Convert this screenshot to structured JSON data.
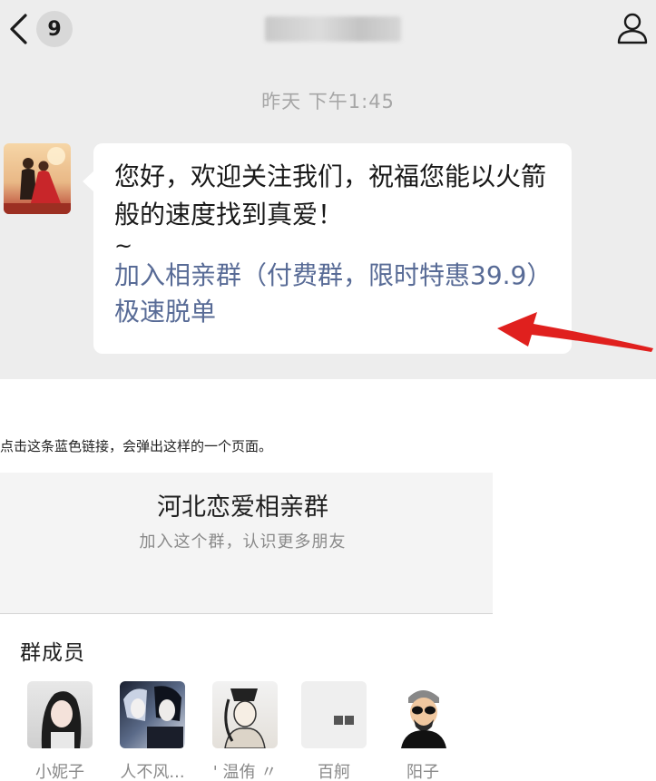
{
  "chat": {
    "unread_badge": "9",
    "timestamp": "昨天 下午1:45",
    "message": {
      "greeting": "您好，欢迎关注我们，祝福您能以火箭般的速度找到真爱！",
      "tilde": "~",
      "link_text": "加入相亲群（付费群，限时特惠39.9）极速脱单",
      "link_color": "#586b96"
    },
    "icons": [
      "chevron-left-icon",
      "person-icon"
    ]
  },
  "article": {
    "caption": "点击这条蓝色链接，会弹出这样的一个页面。"
  },
  "group_page": {
    "title": "河北恋爱相亲群",
    "subtitle": "加入这个群，认识更多朋友",
    "members_label": "群成员",
    "members": [
      {
        "name": "小妮子"
      },
      {
        "name": "人不风..."
      },
      {
        "name": "' 温侑 〃"
      },
      {
        "name": "百舸"
      },
      {
        "name": "阳子"
      }
    ]
  },
  "colors": {
    "chat_background": "#ededed",
    "bubble": "#ffffff",
    "arrow": "#e0201e"
  }
}
